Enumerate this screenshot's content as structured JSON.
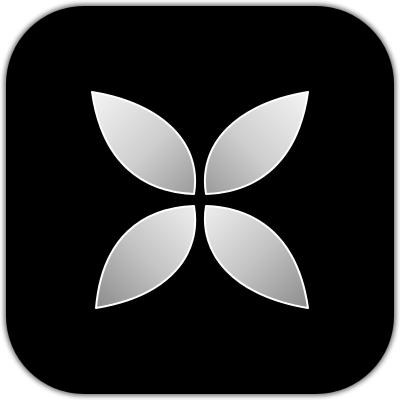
{
  "icon": {
    "name": "four-petal-x-icon",
    "shape": "rounded-square",
    "colors": {
      "background": "#000000",
      "petal_light": "#f2f2f2",
      "petal_mid": "#c9c9c9",
      "petal_dark": "#8e8e8e",
      "petal_edge": "#ffffff"
    }
  }
}
